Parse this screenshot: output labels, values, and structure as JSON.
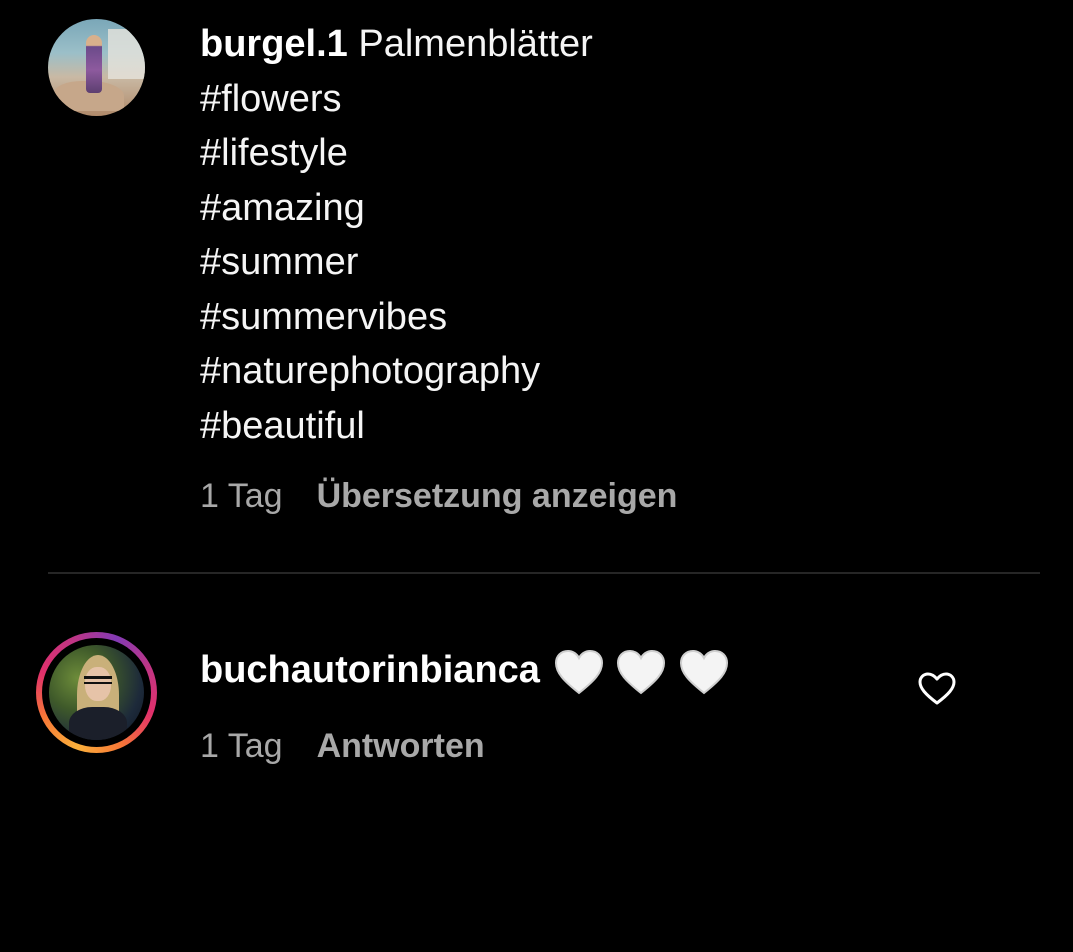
{
  "caption": {
    "username": "burgel.1",
    "title": "Palmenblätter",
    "hashtags": [
      "#flowers",
      "#lifestyle",
      "#amazing",
      "#summer",
      "#summervibes",
      "#naturephotography",
      "#beautiful"
    ],
    "time": "1 Tag",
    "translate_label": "Übersetzung anzeigen"
  },
  "comment": {
    "username": "buchautorinbianca",
    "emoji_count": 3,
    "emoji": "white-heart-emoji",
    "time": "1 Tag",
    "reply_label": "Antworten",
    "like_icon": "heart-outline-icon",
    "story_ring_colors": [
      "#fbb03b",
      "#f77737",
      "#e1306c",
      "#c13584",
      "#833ab4"
    ]
  },
  "colors": {
    "background": "#000000",
    "text_primary": "#f5f5f5",
    "text_secondary": "#a8a8a8",
    "divider": "#262626"
  }
}
